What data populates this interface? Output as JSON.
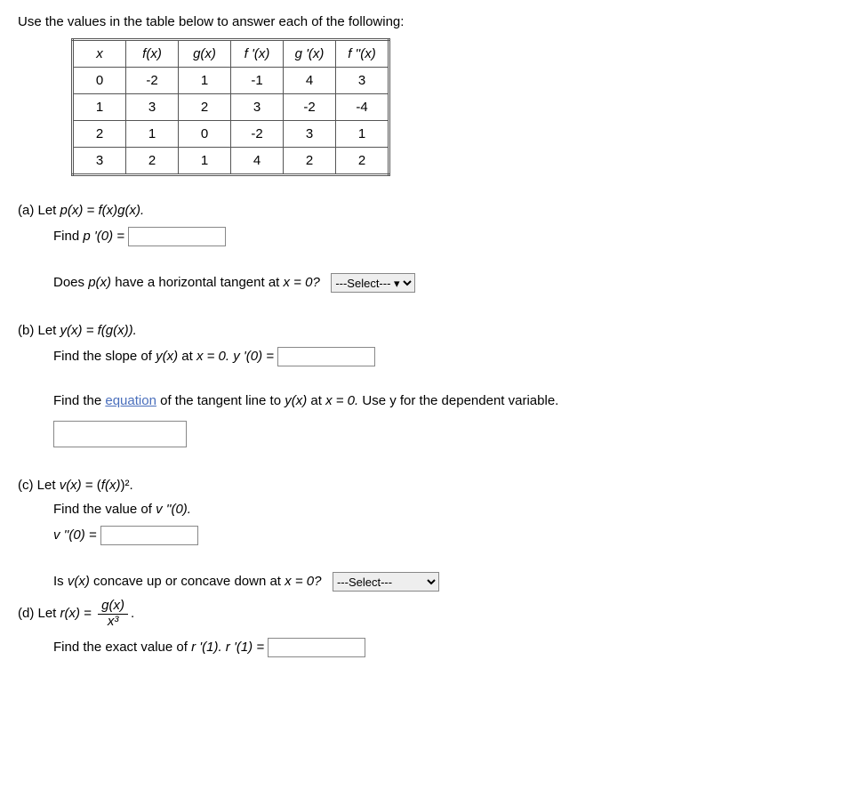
{
  "intro": "Use the values in the table below to answer each of the following:",
  "table": {
    "headers": [
      "x",
      "f(x)",
      "g(x)",
      "f '(x)",
      "g '(x)",
      "f ''(x)"
    ],
    "rows": [
      [
        "0",
        "-2",
        "1",
        "-1",
        "4",
        "3"
      ],
      [
        "1",
        "3",
        "2",
        "3",
        "-2",
        "-4"
      ],
      [
        "2",
        "1",
        "0",
        "-2",
        "3",
        "1"
      ],
      [
        "3",
        "2",
        "1",
        "4",
        "2",
        "2"
      ]
    ]
  },
  "a": {
    "label": "(a) Let ",
    "def_lhs": "p(x)",
    "def_rhs": " = f(x)g(x).",
    "find_label": "Find ",
    "find_expr": "p '(0) =",
    "q_prefix": "Does ",
    "q_fn": "p(x)",
    "q_mid": " have a horizontal tangent at ",
    "q_xeq": "x = 0?",
    "select_default": "---Select--- ▾"
  },
  "b": {
    "label": "(b) Let ",
    "def_lhs": "y(x)",
    "def_rhs": " = f(g(x)).",
    "slope_prefix": "Find the slope of ",
    "slope_fn": "y(x)",
    "slope_mid": " at ",
    "slope_xeq": "x = 0. ",
    "slope_expr": "y '(0) =",
    "tan_prefix": "Find the ",
    "tan_link": "equation",
    "tan_mid": " of the tangent line to ",
    "tan_fn": "y(x)",
    "tan_at": " at ",
    "tan_xeq": "x = 0. ",
    "tan_suffix": "Use y for the dependent variable."
  },
  "c": {
    "label": "(c) Let ",
    "def_lhs": "v(x)",
    "def_rhs_pre": " = (",
    "def_rhs_fn": "f(x)",
    "def_rhs_post": ")²",
    "def_period": ".",
    "find_label": "Find the value of ",
    "find_expr": "v ''(0).",
    "v_expr": "v ''(0) =",
    "q_prefix": "Is ",
    "q_fn": "v(x)",
    "q_mid": " concave up or concave down at ",
    "q_xeq": "x = 0?",
    "select_default": "---Select---"
  },
  "d": {
    "label": "(d) Let ",
    "def_lhs": " r(x)",
    "eq": " = ",
    "frac_num": "g(x)",
    "frac_den": "x³",
    "frac_period": ".",
    "find_label": "Find the exact value of ",
    "find_expr1": "r '(1). ",
    "find_expr2": "r '(1) ="
  }
}
